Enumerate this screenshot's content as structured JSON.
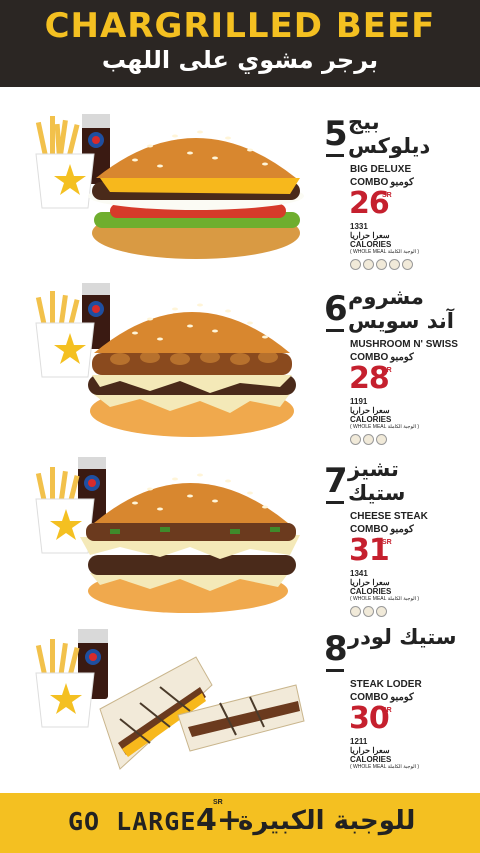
{
  "header": {
    "title": "CHARGRILLED BEEF",
    "subtitle_ar": "برجر مشوي على اللهب"
  },
  "items": [
    {
      "number": "5",
      "name_ar": "بيج ديلوكس",
      "name_en": "BIG DELUXE",
      "combo_en": "COMBO",
      "combo_ar": "كومبو",
      "price": "26",
      "currency": "SR",
      "calories": "1331",
      "calories_ar": "سعرا حراريا",
      "calories_en": "CALORIES",
      "meal_note": "( WHOLE MEAL الوجبة الكاملة )"
    },
    {
      "number": "6",
      "name_ar": "مشروم آند سويس",
      "name_en": "MUSHROOM N' SWISS",
      "combo_en": "COMBO",
      "combo_ar": "كومبو",
      "price": "28",
      "currency": "SR",
      "calories": "1191",
      "calories_ar": "سعرا حراريا",
      "calories_en": "CALORIES",
      "meal_note": "( WHOLE MEAL الوجبة الكاملة )"
    },
    {
      "number": "7",
      "name_ar": "تشيز ستيك",
      "name_en": "CHEESE STEAK",
      "combo_en": "COMBO",
      "combo_ar": "كومبو",
      "price": "31",
      "currency": "SR",
      "calories": "1341",
      "calories_ar": "سعرا حراريا",
      "calories_en": "CALORIES",
      "meal_note": "( WHOLE MEAL الوجبة الكاملة )"
    },
    {
      "number": "8",
      "name_ar": "ستيك لودر",
      "name_en": "STEAK LODER",
      "combo_en": "COMBO",
      "combo_ar": "كومبو",
      "price": "30",
      "currency": "SR",
      "calories": "1211",
      "calories_ar": "سعرا حراريا",
      "calories_en": "CALORIES",
      "meal_note": "( WHOLE MEAL الوجبة الكاملة )"
    }
  ],
  "footer": {
    "go_large": "GO LARGE",
    "plus_price": "4+",
    "currency": "SR",
    "label_ar": "للوجبة الكبيرة"
  },
  "colors": {
    "header_bg": "#2b2623",
    "title": "#f4c021",
    "price": "#c5202e",
    "footer_bg": "#f4c021"
  }
}
